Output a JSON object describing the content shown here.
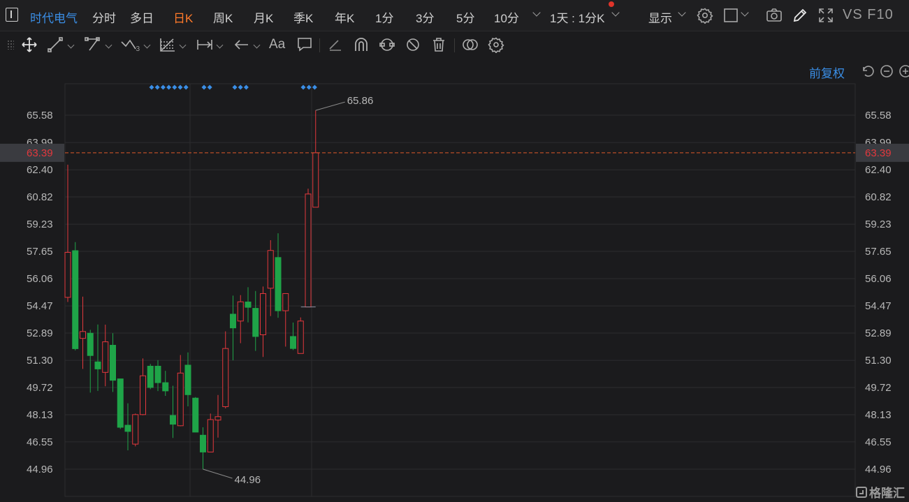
{
  "topbar": {
    "stock_name": "时代电气",
    "periods": [
      "分时",
      "多日",
      "日K",
      "周K",
      "月K",
      "季K",
      "年K",
      "1分",
      "3分",
      "5分",
      "10分"
    ],
    "active_period": "日K",
    "multi_period": "1天 : 1分K",
    "display_label": "显示",
    "vs_f10": "VS F10",
    "icons": [
      "sidebar-toggle-icon",
      "settings-icon",
      "layout-icon",
      "camera-icon",
      "pen-icon",
      "fullscreen-icon"
    ]
  },
  "drawing_toolbar": {
    "icons": [
      "move-icon",
      "line-icon",
      "polyline-icon",
      "wave-icon",
      "fibonacci-icon",
      "range-icon",
      "arrow-icon",
      "text-icon",
      "note-icon",
      "eraser-icon",
      "magnet-icon",
      "lock-icon",
      "hide-icon",
      "delete-icon",
      "overlay-icon",
      "gear-icon"
    ],
    "text_tool_label": "Aa",
    "wave_sub": "3"
  },
  "adjust": {
    "label": "前复权",
    "icons": [
      "undo-icon",
      "zoom-out-icon",
      "zoom-in-icon"
    ]
  },
  "watermark": "格隆汇",
  "colors": {
    "up": "#e3383d",
    "down": "#1fa448",
    "accent": "#3a8ee6",
    "active_tab": "#ff7a2a",
    "price_line": "#e05a2a"
  },
  "chart_data": {
    "type": "candlestick",
    "y_ticks": [
      "65.58",
      "63.99",
      "62.40",
      "60.82",
      "59.23",
      "57.65",
      "56.06",
      "54.47",
      "52.89",
      "51.30",
      "49.72",
      "48.13",
      "46.55",
      "44.96"
    ],
    "ylim": [
      44.96,
      65.58
    ],
    "current_price": "63.39",
    "high_label": "65.86",
    "low_label": "44.96",
    "grid": true,
    "candles": [
      {
        "o": 54.97,
        "h": 62.7,
        "l": 54.7,
        "c": 57.59
      },
      {
        "o": 57.69,
        "h": 58.19,
        "l": 51.88,
        "c": 51.98
      },
      {
        "o": 52.58,
        "h": 55.01,
        "l": 50.8,
        "c": 52.98
      },
      {
        "o": 52.88,
        "h": 53.08,
        "l": 49.42,
        "c": 51.58
      },
      {
        "o": 51.21,
        "h": 53.39,
        "l": 49.52,
        "c": 50.8
      },
      {
        "o": 50.6,
        "h": 53.38,
        "l": 49.79,
        "c": 52.38
      },
      {
        "o": 52.18,
        "h": 52.88,
        "l": 49.46,
        "c": 50.14
      },
      {
        "o": 50.22,
        "h": 50.22,
        "l": 47.3,
        "c": 47.4
      },
      {
        "o": 47.52,
        "h": 48.8,
        "l": 46.06,
        "c": 47.16
      },
      {
        "o": 46.42,
        "h": 48.2,
        "l": 46.29,
        "c": 48.14
      },
      {
        "o": 48.14,
        "h": 51.41,
        "l": 48.1,
        "c": 50.4
      },
      {
        "o": 50.96,
        "h": 51.09,
        "l": 49.62,
        "c": 49.72
      },
      {
        "o": 50.96,
        "h": 51.31,
        "l": 49.51,
        "c": 50.0
      },
      {
        "o": 50.0,
        "h": 50.69,
        "l": 49.23,
        "c": 49.52
      },
      {
        "o": 48.09,
        "h": 49.82,
        "l": 46.78,
        "c": 47.58
      },
      {
        "o": 47.49,
        "h": 51.61,
        "l": 47.46,
        "c": 50.56
      },
      {
        "o": 51.02,
        "h": 51.76,
        "l": 48.62,
        "c": 49.3
      },
      {
        "o": 49.1,
        "h": 49.16,
        "l": 47.2,
        "c": 47.12
      },
      {
        "o": 46.94,
        "h": 47.4,
        "l": 44.96,
        "c": 45.96
      },
      {
        "o": 45.96,
        "h": 48.2,
        "l": 45.96,
        "c": 47.85
      },
      {
        "o": 47.82,
        "h": 49.28,
        "l": 46.8,
        "c": 48.02
      },
      {
        "o": 48.6,
        "h": 52.99,
        "l": 48.5,
        "c": 51.99
      },
      {
        "o": 53.99,
        "h": 55.07,
        "l": 51.3,
        "c": 53.19
      },
      {
        "o": 53.59,
        "h": 55.1,
        "l": 52.3,
        "c": 54.71
      },
      {
        "o": 54.7,
        "h": 55.56,
        "l": 53.51,
        "c": 54.39
      },
      {
        "o": 54.33,
        "h": 55.34,
        "l": 51.85,
        "c": 52.69
      },
      {
        "o": 52.79,
        "h": 55.6,
        "l": 51.5,
        "c": 55.19
      },
      {
        "o": 55.5,
        "h": 58.3,
        "l": 53.88,
        "c": 57.7
      },
      {
        "o": 57.29,
        "h": 58.7,
        "l": 53.78,
        "c": 54.19
      },
      {
        "o": 54.19,
        "h": 54.77,
        "l": 52.1,
        "c": 55.19
      },
      {
        "o": 52.69,
        "h": 53.5,
        "l": 51.9,
        "c": 51.99
      },
      {
        "o": 51.7,
        "h": 53.8,
        "l": 51.7,
        "c": 53.59
      },
      {
        "o": 54.41,
        "h": 61.3,
        "l": 54.41,
        "c": 60.99
      },
      {
        "o": 60.22,
        "h": 65.86,
        "l": 60.22,
        "c": 63.39
      }
    ],
    "event_marker_groups": [
      7,
      2,
      3,
      3
    ]
  }
}
